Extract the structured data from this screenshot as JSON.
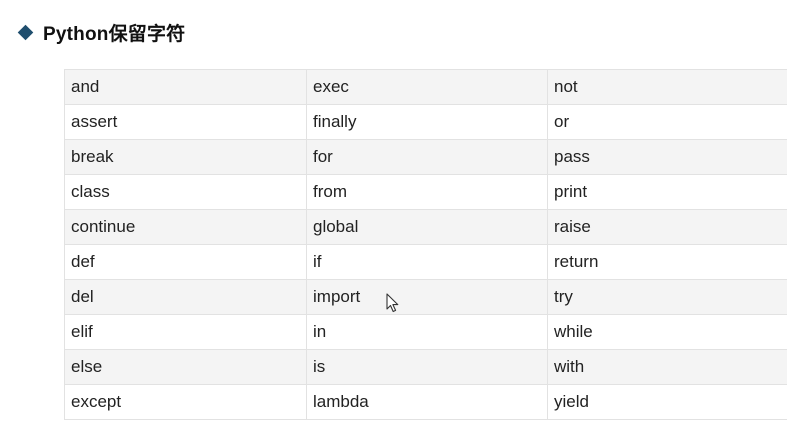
{
  "heading": {
    "title": "Python保留字符"
  },
  "keywords_table": {
    "rows": [
      [
        "and",
        "exec",
        "not"
      ],
      [
        "assert",
        "finally",
        "or"
      ],
      [
        "break",
        "for",
        "pass"
      ],
      [
        "class",
        "from",
        "print"
      ],
      [
        "continue",
        "global",
        "raise"
      ],
      [
        "def",
        "if",
        "return"
      ],
      [
        "del",
        "import",
        "try"
      ],
      [
        "elif",
        "in",
        "while"
      ],
      [
        "else",
        "is",
        "with"
      ],
      [
        "except",
        "lambda",
        "yield"
      ]
    ]
  },
  "colors": {
    "bullet": "#1f4e6e",
    "row_shade": "#f4f4f4",
    "border": "#e2e2e2"
  },
  "icons": {
    "bullet": "diamond-bullet-icon",
    "pointer": "mouse-pointer-icon"
  }
}
